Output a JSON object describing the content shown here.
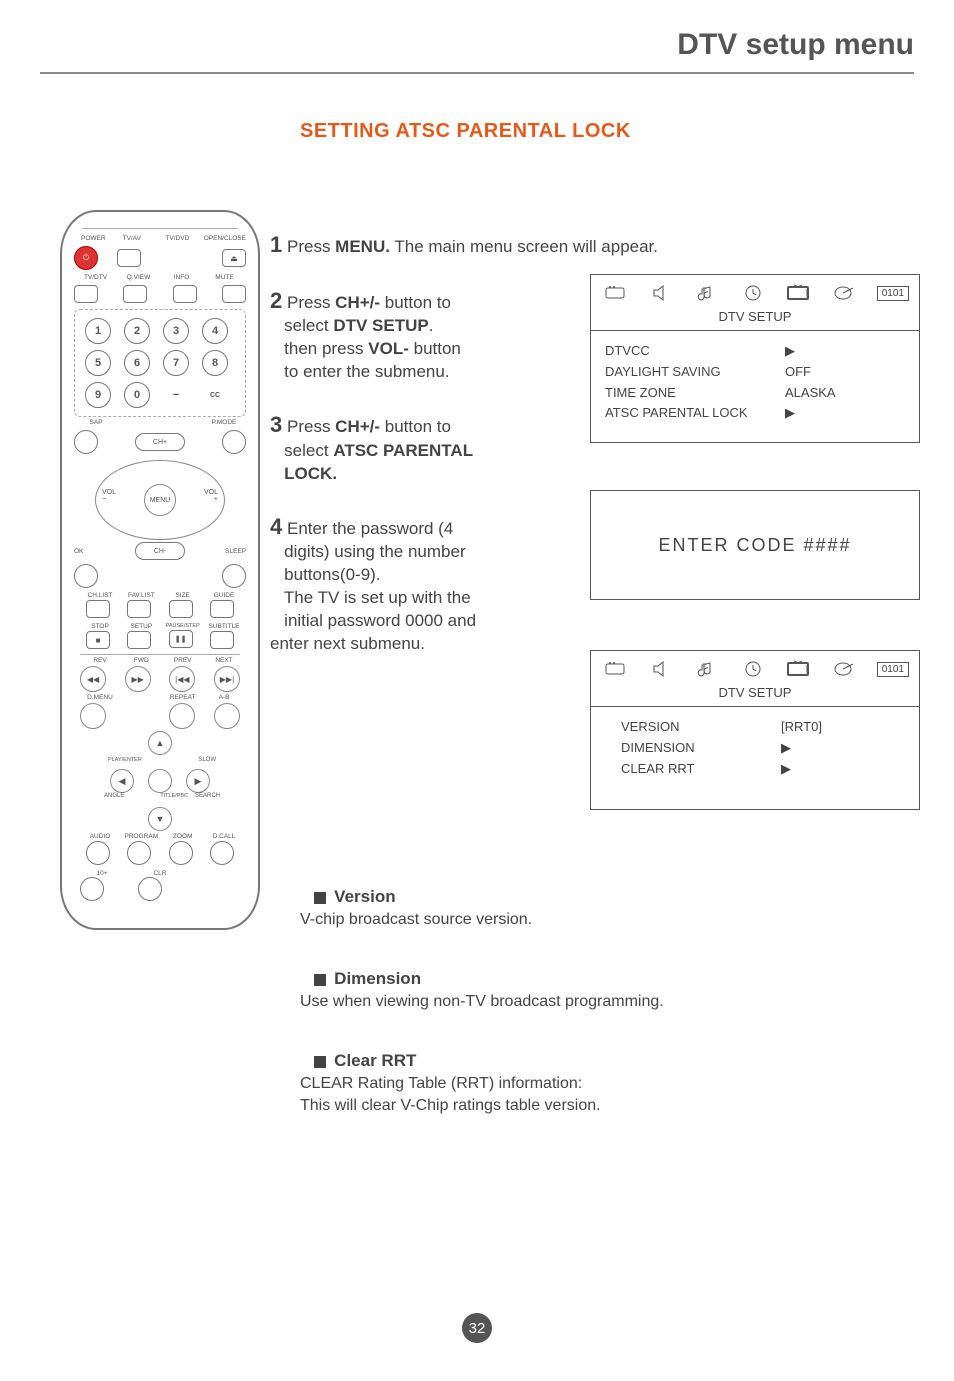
{
  "header": {
    "title": "DTV setup menu"
  },
  "section_title": "SETTING ATSC PARENTAL LOCK",
  "remote": {
    "row1": {
      "power": "POWER",
      "tvav": "TV/AV",
      "tvdvd": "TV/DVD",
      "openclose": "OPEN/CLOSE",
      "eject": "⏏"
    },
    "row2": {
      "tvdtv": "TV/DTV",
      "qview": "Q.VIEW",
      "info": "INFO",
      "mute": "MUTE"
    },
    "nums": [
      "1",
      "2",
      "3",
      "4",
      "5",
      "6",
      "7",
      "8",
      "9",
      "0",
      "−",
      "CC"
    ],
    "sap": "SAP",
    "pmode": "P.MODE",
    "chp": "CH+",
    "chm": "CH-",
    "volm": "VOL\n−",
    "volp": "VOL\n+",
    "menu": "MENU",
    "ok": "OK",
    "sleep": "SLEEP",
    "row_small1": {
      "chlist": "CH.LIST",
      "favlist": "FAV.LIST",
      "size": "SIZE",
      "guide": "GUIDE"
    },
    "row_small2": {
      "stop": "STOP",
      "setup": "SETUP",
      "pausestep": "PAUSE/STEP",
      "subtitle": "SUBTITLE",
      "stop_sym": "■",
      "pause_sym": "❚❚"
    },
    "row_media1": {
      "rev": "REV",
      "fwd": "FWD",
      "prev": "PREV",
      "next": "NEXT",
      "rev_s": "◀◀",
      "fwd_s": "▶▶",
      "prev_s": "|◀◀",
      "next_s": "▶▶|"
    },
    "row_media2": {
      "dmenu": "D.MENU",
      "repeat": "REPEAT",
      "ab": "A-B"
    },
    "dpad": {
      "playenter": "PLAY/ENTER",
      "slow": "SLOW",
      "angle": "ANGLE",
      "titlepbc": "TITLE/PBC",
      "search": "SEARCH",
      "u": "▲",
      "d": "▼",
      "l": "◀",
      "r": "▶"
    },
    "row_last": {
      "audio": "AUDIO",
      "program": "PROGRAM",
      "zoom": "ZOOM",
      "dcall": "D.CALL"
    },
    "row_bottom": {
      "tenplus": "10+",
      "clr": "CLR"
    }
  },
  "steps": {
    "s1": {
      "num": "1",
      "pre": "Press ",
      "b": "MENU.",
      "post": " The main menu screen will appear."
    },
    "s2": {
      "num": "2",
      "l1a": "Press ",
      "l1b": "CH+/-",
      "l1c": " button to",
      "l2a": "select ",
      "l2b": "DTV SETUP",
      "l2c": ".",
      "l3a": "then press ",
      "l3b": "VOL-",
      "l3c": " button",
      "l4": "to enter the submenu."
    },
    "s3": {
      "num": "3",
      "l1a": "Press ",
      "l1b": "CH+/-",
      "l1c": " button to",
      "l2a": "select ",
      "l2b": "ATSC PARENTAL",
      "l3": "LOCK."
    },
    "s4": {
      "num": "4",
      "l1": "Enter the password (4",
      "l2": "digits) using the number",
      "l3": "buttons(0-9).",
      "l4": " The TV is set up with the",
      "l5": " initial password 0000 and",
      "l6": "enter next submenu."
    }
  },
  "osd1": {
    "code": "0101",
    "caption": "DTV SETUP",
    "lines": [
      {
        "k": "DTVCC",
        "v": "▶"
      },
      {
        "k": "DAYLIGHT SAVING",
        "v": "OFF"
      },
      {
        "k": "TIME ZONE",
        "v": "ALASKA"
      },
      {
        "k": "ATSC PARENTAL LOCK",
        "v": "▶"
      }
    ]
  },
  "osd2": {
    "text": "ENTER CODE    ####"
  },
  "osd3": {
    "code": "0101",
    "caption": "DTV SETUP",
    "lines": [
      {
        "k": "VERSION",
        "v": "[RRT0]"
      },
      {
        "k": "DIMENSION",
        "v": "▶"
      },
      {
        "k": "CLEAR RRT",
        "v": "▶"
      }
    ]
  },
  "desc": {
    "version": {
      "h": "Version",
      "t": "V-chip broadcast source version."
    },
    "dimension": {
      "h": "Dimension",
      "t": "Use when viewing non-TV broadcast programming."
    },
    "clear": {
      "h": "Clear RRT",
      "t1": "CLEAR Rating Table (RRT) information:",
      "t2": "This will clear V-Chip ratings table version."
    }
  },
  "page": "32"
}
